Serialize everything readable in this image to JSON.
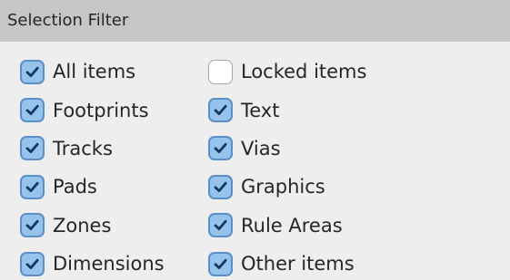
{
  "panel": {
    "title": "Selection Filter",
    "items": [
      {
        "label": "All items",
        "checked": true
      },
      {
        "label": "Locked items",
        "checked": false
      },
      {
        "label": "Footprints",
        "checked": true
      },
      {
        "label": "Text",
        "checked": true
      },
      {
        "label": "Tracks",
        "checked": true
      },
      {
        "label": "Vias",
        "checked": true
      },
      {
        "label": "Pads",
        "checked": true
      },
      {
        "label": "Graphics",
        "checked": true
      },
      {
        "label": "Zones",
        "checked": true
      },
      {
        "label": "Rule Areas",
        "checked": true
      },
      {
        "label": "Dimensions",
        "checked": true
      },
      {
        "label": "Other items",
        "checked": true
      }
    ]
  },
  "colors": {
    "header_bg": "#c6c6c6",
    "panel_bg": "#eeeeee",
    "check_fill": "#96c3ec",
    "check_border": "#5b8fc6",
    "check_mark": "#14375e"
  }
}
